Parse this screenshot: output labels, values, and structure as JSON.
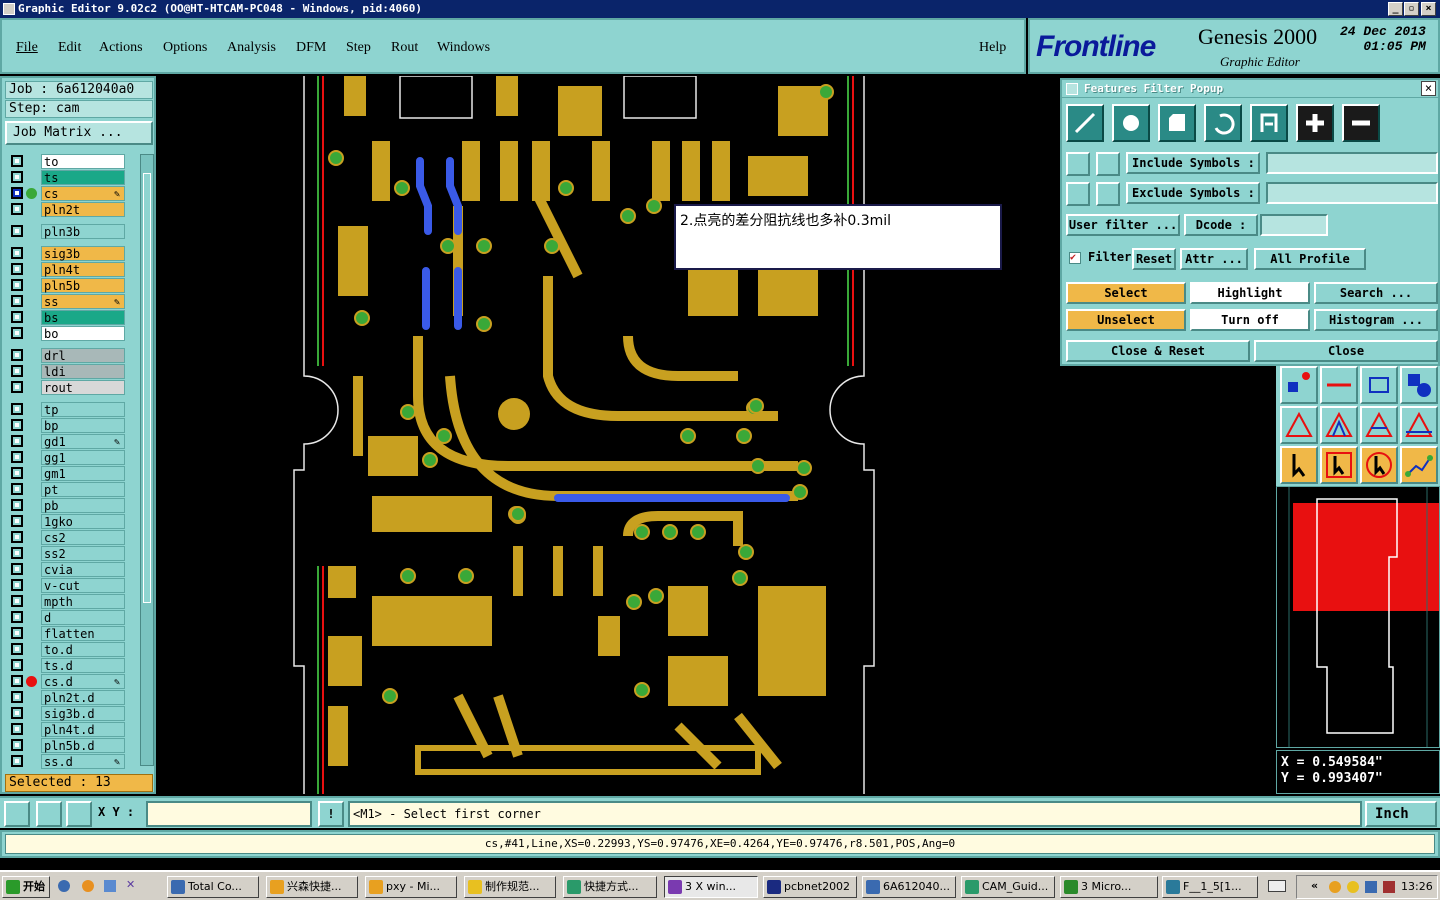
{
  "window": {
    "title": "Graphic Editor 9.02c2 (OO@HT-HTCAM-PC048 - Windows, pid:4060)",
    "min": "_",
    "max": "▫",
    "close": "×"
  },
  "menu": {
    "items": [
      "File",
      "Edit",
      "Actions",
      "Options",
      "Analysis",
      "DFM",
      "Step",
      "Rout",
      "Windows"
    ],
    "help": "Help"
  },
  "brand": {
    "logo": "Frontline",
    "product": "Genesis 2000",
    "subtitle": "Graphic Editor",
    "date": "24 Dec 2013",
    "time": "01:05 PM"
  },
  "job": {
    "job_line": "Job : 6a612040a0",
    "step_line": "Step: cam",
    "matrix_button": "Job Matrix ..."
  },
  "layers": [
    {
      "name": "to",
      "color": "#ffffff"
    },
    {
      "name": "ts",
      "color": "#1aa888"
    },
    {
      "name": "cs",
      "color": "#f0b848",
      "active": true,
      "edit": true
    },
    {
      "name": "pln2t",
      "color": "#f0b848"
    },
    {
      "name": "pln3b",
      "color": "#8ed4d0"
    },
    {
      "name": "sig3b",
      "color": "#f0b848"
    },
    {
      "name": "pln4t",
      "color": "#f0b848"
    },
    {
      "name": "pln5b",
      "color": "#f0b848"
    },
    {
      "name": "ss",
      "color": "#f0b848",
      "edit": true
    },
    {
      "name": "bs",
      "color": "#1aa888"
    },
    {
      "name": "bo",
      "color": "#ffffff"
    },
    {
      "name": "drl",
      "color": "#a8b8b8"
    },
    {
      "name": "ldi",
      "color": "#a8b8b8"
    },
    {
      "name": "rout",
      "color": "#d8d8d8"
    },
    {
      "name": "tp",
      "color": "#8ed4d0"
    },
    {
      "name": "bp",
      "color": "#8ed4d0"
    },
    {
      "name": "gd1",
      "color": "#8ed4d0",
      "edit": true
    },
    {
      "name": "gg1",
      "color": "#8ed4d0"
    },
    {
      "name": "gm1",
      "color": "#8ed4d0"
    },
    {
      "name": "pt",
      "color": "#8ed4d0"
    },
    {
      "name": "pb",
      "color": "#8ed4d0"
    },
    {
      "name": "1gko",
      "color": "#8ed4d0"
    },
    {
      "name": "cs2",
      "color": "#8ed4d0"
    },
    {
      "name": "ss2",
      "color": "#8ed4d0"
    },
    {
      "name": "cvia",
      "color": "#8ed4d0"
    },
    {
      "name": "v-cut",
      "color": "#8ed4d0"
    },
    {
      "name": "mpth",
      "color": "#8ed4d0"
    },
    {
      "name": "d",
      "color": "#8ed4d0"
    },
    {
      "name": "flatten",
      "color": "#8ed4d0"
    },
    {
      "name": "to.d",
      "color": "#8ed4d0"
    },
    {
      "name": "ts.d",
      "color": "#8ed4d0"
    },
    {
      "name": "cs.d",
      "color": "#8ed4d0",
      "mark": "#e81010",
      "edit": true
    },
    {
      "name": "pln2t.d",
      "color": "#8ed4d0"
    },
    {
      "name": "sig3b.d",
      "color": "#8ed4d0"
    },
    {
      "name": "pln4t.d",
      "color": "#8ed4d0"
    },
    {
      "name": "pln5b.d",
      "color": "#8ed4d0"
    },
    {
      "name": "ss.d",
      "color": "#8ed4d0",
      "edit": true
    }
  ],
  "selected": "Selected : 13",
  "annotation": "2.点亮的差分阻抗线也多补0.3mil",
  "filter_popup": {
    "title": "Features Filter Popup",
    "include_symbols": "Include Symbols :",
    "exclude_symbols": "Exclude Symbols :",
    "user_filter": "User filter ...",
    "dcode": "Dcode :",
    "filter_toggle": "Filter",
    "reset": "Reset",
    "attr": "Attr ...",
    "profile": "All Profile",
    "select": "Select",
    "highlight": "Highlight",
    "search": "Search ...",
    "unselect": "Unselect",
    "turn_off": "Turn off",
    "histogram": "Histogram ...",
    "close_reset": "Close & Reset",
    "close": "Close",
    "close_icon": "×"
  },
  "coords": {
    "x": "X = 0.549584\"",
    "y": "Y = 0.993407\""
  },
  "bottom": {
    "xy_label": "X Y :",
    "xy_value": "",
    "message": "<M1> - Select first corner",
    "unit": "Inch"
  },
  "status": "cs,#41,Line,XS=0.22993,YS=0.97476,XE=0.4264,YE=0.97476,r8.501,POS,Ang=0",
  "taskbar": {
    "start": "开始",
    "tasks": [
      "Total Co...",
      "兴森快捷...",
      "pxy - Mi...",
      "制作规范...",
      "快捷方式...",
      "3 X win...",
      "pcbnet2002",
      "6A612040...",
      "CAM_Guid...",
      "3 Micro...",
      "F__1_5[1..."
    ],
    "clock": "13:26",
    "tray_chevron": "«"
  },
  "colors": {
    "copper": "#c8a020",
    "pad_green": "#3aa838",
    "highlight": "#3a5ae8",
    "panel": "#8ed4d0"
  }
}
